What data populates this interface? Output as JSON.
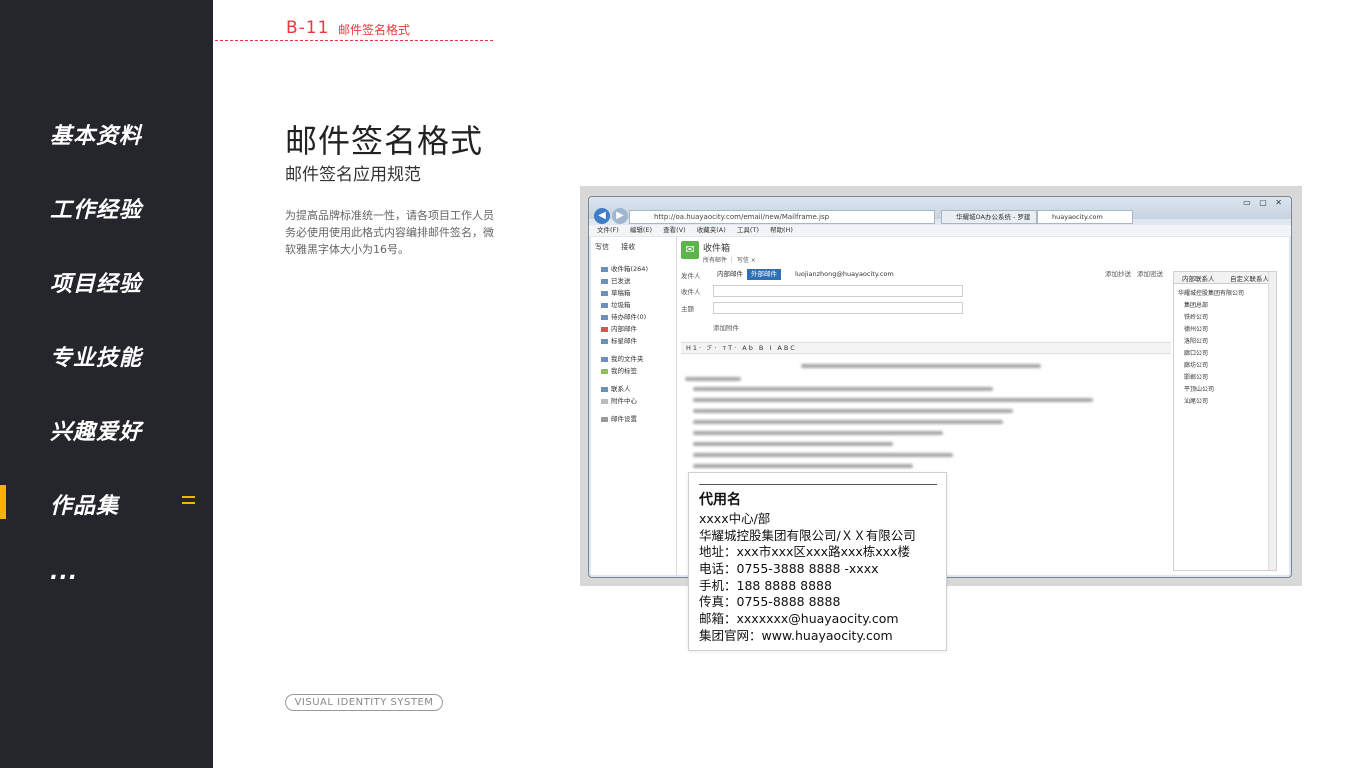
{
  "sidebar": {
    "items": [
      {
        "label": "基本资料"
      },
      {
        "label": "工作经验"
      },
      {
        "label": "项目经验"
      },
      {
        "label": "专业技能"
      },
      {
        "label": "兴趣爱好"
      },
      {
        "label": "作品集"
      },
      {
        "label": "..."
      }
    ],
    "active_index": 5,
    "accent_color": "#f5b400",
    "background_color": "#25262b"
  },
  "header": {
    "code": "B-11",
    "code_title": "邮件签名格式",
    "accent_color": "#e8393f"
  },
  "content": {
    "title": "邮件签名格式",
    "subtitle": "邮件签名应用规范",
    "description": "为提高品牌标准统一性，请各项目工作人员务必使用使用此格式内容编排邮件签名，微软雅黑字体大小为16号。"
  },
  "footer": {
    "tag": "VISUAL IDENTITY SYSTEM"
  },
  "browser": {
    "address": "http://oa.huayaocity.com/email/new/Mailframe.jsp",
    "tabs": [
      "华耀城OA办公系统 - 罗建忠",
      "huayaocity.com"
    ],
    "menu": [
      "文件(F)",
      "编辑(E)",
      "查看(V)",
      "收藏夹(A)",
      "工具(T)",
      "帮助(H)"
    ]
  },
  "mail": {
    "left_buttons": [
      "写信",
      "接收"
    ],
    "folders": [
      "收件箱(264)",
      "已发送",
      "草稿箱",
      "垃圾箱",
      "待办邮件(0)",
      "内部邮件",
      "标星邮件",
      "我的文件夹",
      "我的标签",
      "联系人",
      "附件中心",
      "邮件设置"
    ],
    "inbox_title": "收件箱",
    "inbox_sub": "所有邮件 ｜ 写信 ×",
    "form": {
      "from_label": "发件人",
      "chip_internal": "内部邮件",
      "chip_external": "外部邮件",
      "from_value": "luojianzhong@huayaocity.com",
      "to_label": "收件人",
      "subject_label": "主题",
      "attach_label": "添加附件",
      "cc_label": "添加抄送",
      "bcc_label": "添加密送"
    },
    "toolbar": "H1· ℱ· тT· Ab B I ABC",
    "contacts_tabs": [
      "内部联系人",
      "自定义联系人"
    ],
    "contacts": [
      "华耀城控股集团有限公司",
      "集团总部",
      "铁岭公司",
      "德州公司",
      "洛阳公司",
      "廊口公司",
      "廊坊公司",
      "邯郸公司",
      "平顶山公司",
      "汕尾公司"
    ]
  },
  "signature": {
    "name": "代用名",
    "department": "xxxx中心/部",
    "company": "华耀城控股集团有限公司/ＸＸ有限公司",
    "address": "地址：xxx市xxx区xxx路xxx栋xxx楼",
    "phone": "电话：0755-3888 8888 -xxxx",
    "mobile": "手机：188 8888 8888",
    "fax": "传真：0755-8888 8888",
    "email": "邮箱：xxxxxxx@huayaocity.com",
    "website": "集团官网：www.huayaocity.com"
  }
}
